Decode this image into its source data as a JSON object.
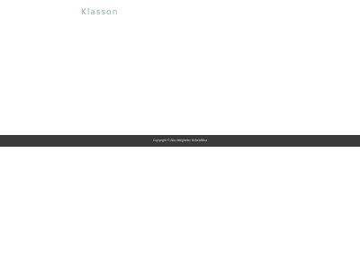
{
  "header": {
    "brand": "Klasson"
  },
  "footer": {
    "copyright": "Copyright © Alla rättigheter förbehållna"
  },
  "colors": {
    "brand": "#7bbfae",
    "footer_background": "#3a3a3a",
    "footer_text": "#d6d6d6",
    "page_background": "#ffffff"
  }
}
